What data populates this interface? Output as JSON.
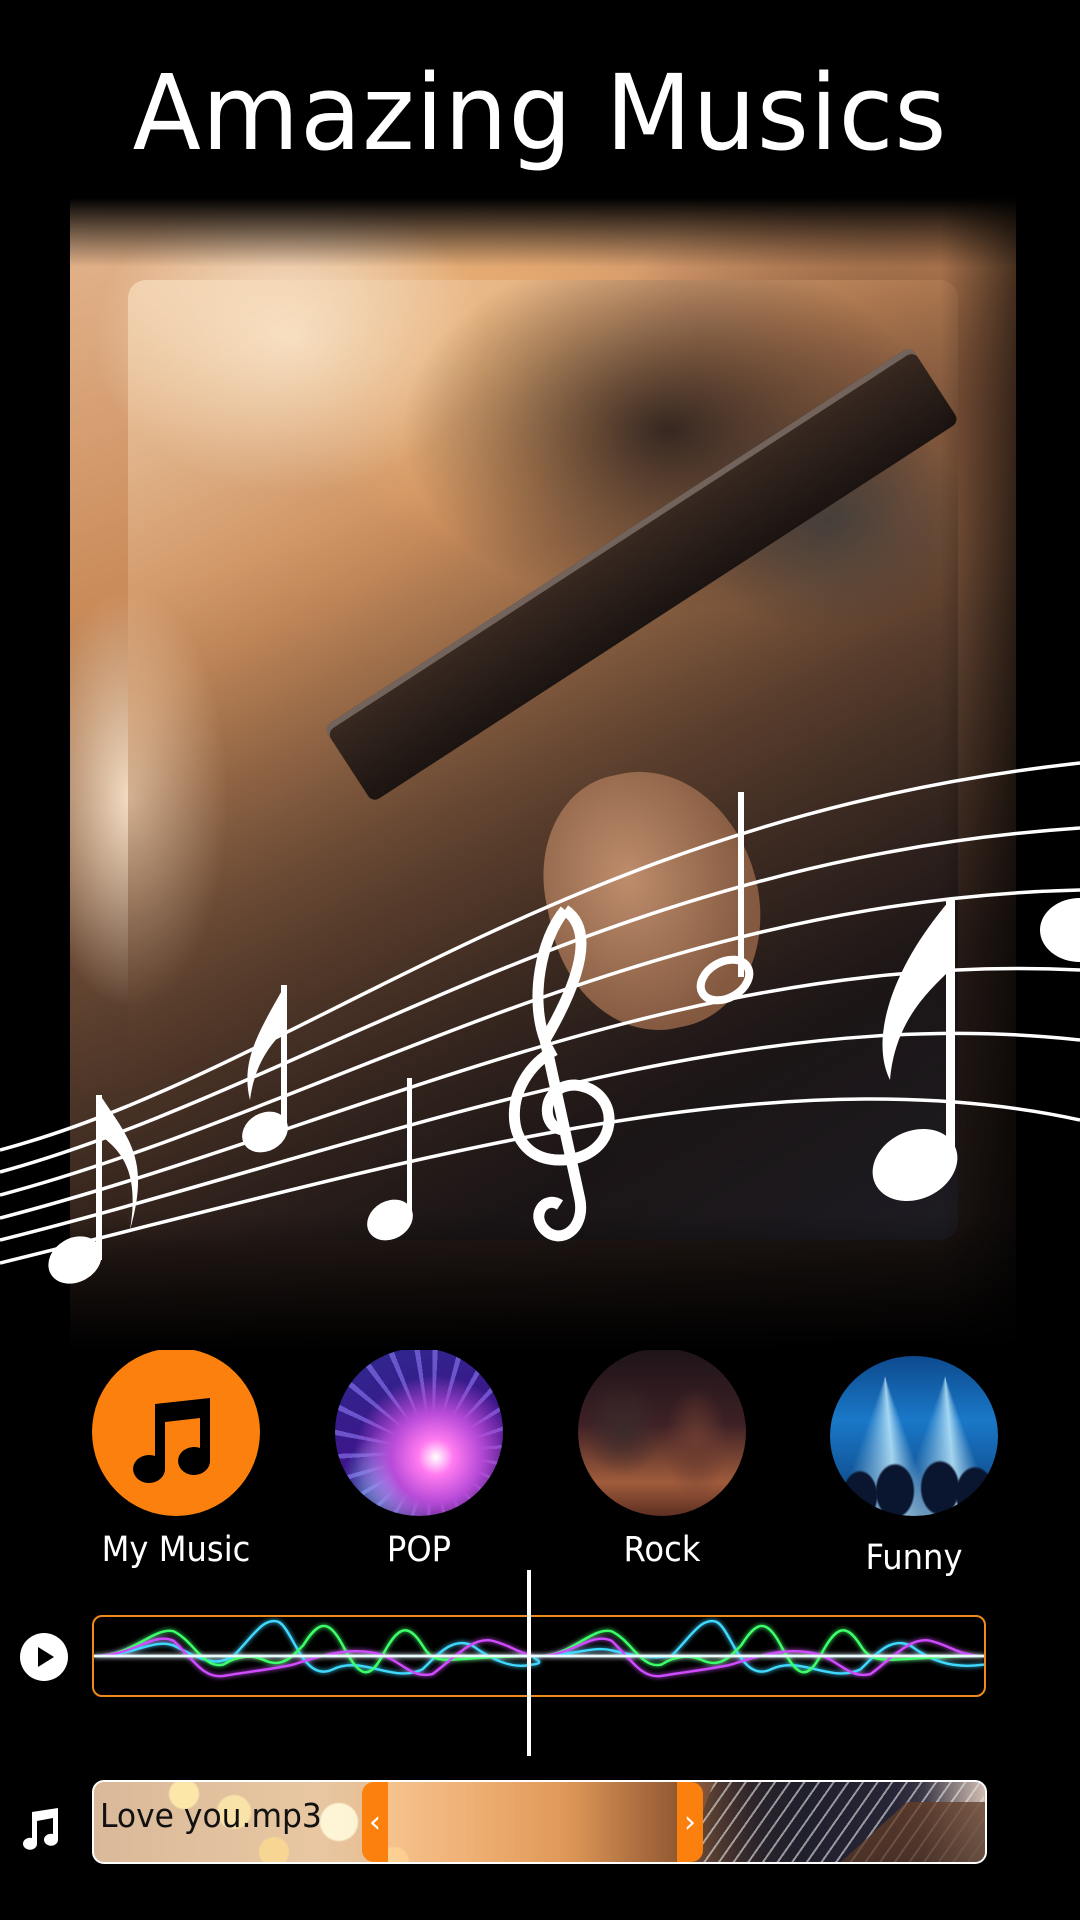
{
  "header": {
    "title": "Amazing Musics"
  },
  "hero": {
    "image": "guitarist-with-music-staff-notes",
    "overlay_icons": [
      "treble-clef-icon",
      "eighth-note-icon",
      "quarter-note-icon",
      "half-note-icon"
    ]
  },
  "categories": [
    {
      "label": "My Music",
      "icon": "music-note-icon",
      "color": "#fb800d"
    },
    {
      "label": "POP",
      "image": "disco-ball"
    },
    {
      "label": "Rock",
      "image": "rock-band-stage"
    },
    {
      "label": "Funny",
      "image": "concert-spotlights"
    }
  ],
  "player": {
    "play_icon": "play-icon",
    "waveform_colors": [
      "#3fd8ff",
      "#3cff6a",
      "#d04cff",
      "#ffffff"
    ],
    "track_border_color": "#f08a1a"
  },
  "clip": {
    "icon": "music-note-icon",
    "filename": "Love you.mp3",
    "handle_left": "‹",
    "handle_right": "›",
    "handle_color": "#fb800d"
  }
}
